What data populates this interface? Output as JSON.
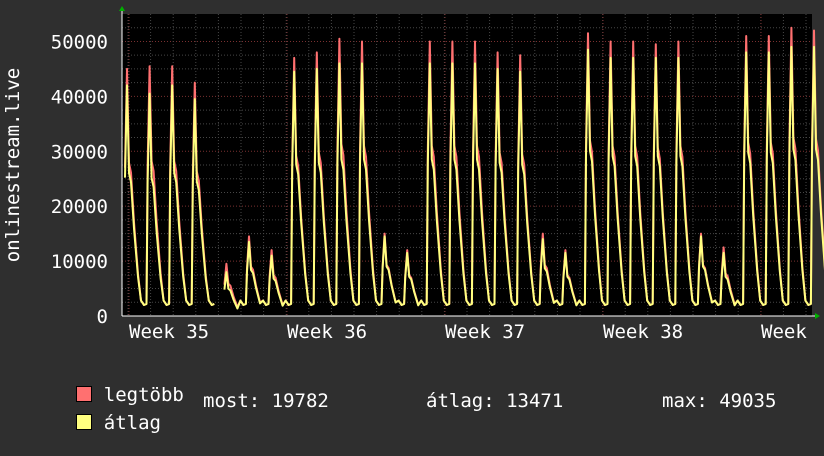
{
  "chart_data": {
    "type": "area",
    "ylabel": "onlinestream.live",
    "ylim": [
      0,
      55000
    ],
    "y_ticks": [
      0,
      10000,
      20000,
      30000,
      40000,
      50000
    ],
    "y_tick_labels": [
      "0",
      "10000",
      "20000",
      "30000",
      "40000",
      "50000"
    ],
    "x_tick_labels": [
      "Week 35",
      "Week 36",
      "Week 37",
      "Week 38",
      "Week"
    ],
    "grid": true,
    "series": [
      {
        "name": "legtöbb",
        "color": "#ff7070",
        "values": [
          45000,
          45500,
          45500,
          42500,
          9500,
          14500,
          12000,
          47000,
          48000,
          50500,
          50000,
          15000,
          12000,
          50000,
          50000,
          50000,
          48000,
          47500,
          15000,
          12000,
          51500,
          50000,
          50000,
          49500,
          50000,
          15000,
          12500,
          51000,
          51000,
          52500,
          52000
        ]
      },
      {
        "name": "átlag",
        "color": "#ffff80",
        "values": [
          42000,
          40500,
          42000,
          39500,
          8000,
          13500,
          11000,
          44500,
          45000,
          46000,
          46000,
          14500,
          11500,
          46000,
          46000,
          46000,
          45000,
          44500,
          14000,
          11500,
          48500,
          47000,
          47000,
          47000,
          47000,
          14500,
          11500,
          48000,
          48000,
          49000,
          49000
        ]
      }
    ],
    "legend_position": "bottom-left"
  },
  "legend": {
    "max_label": "legtöbb",
    "avg_label": "átlag",
    "stat_now": "most: 19782",
    "stat_avg": "átlag: 13471",
    "stat_max": "max: 49035"
  }
}
